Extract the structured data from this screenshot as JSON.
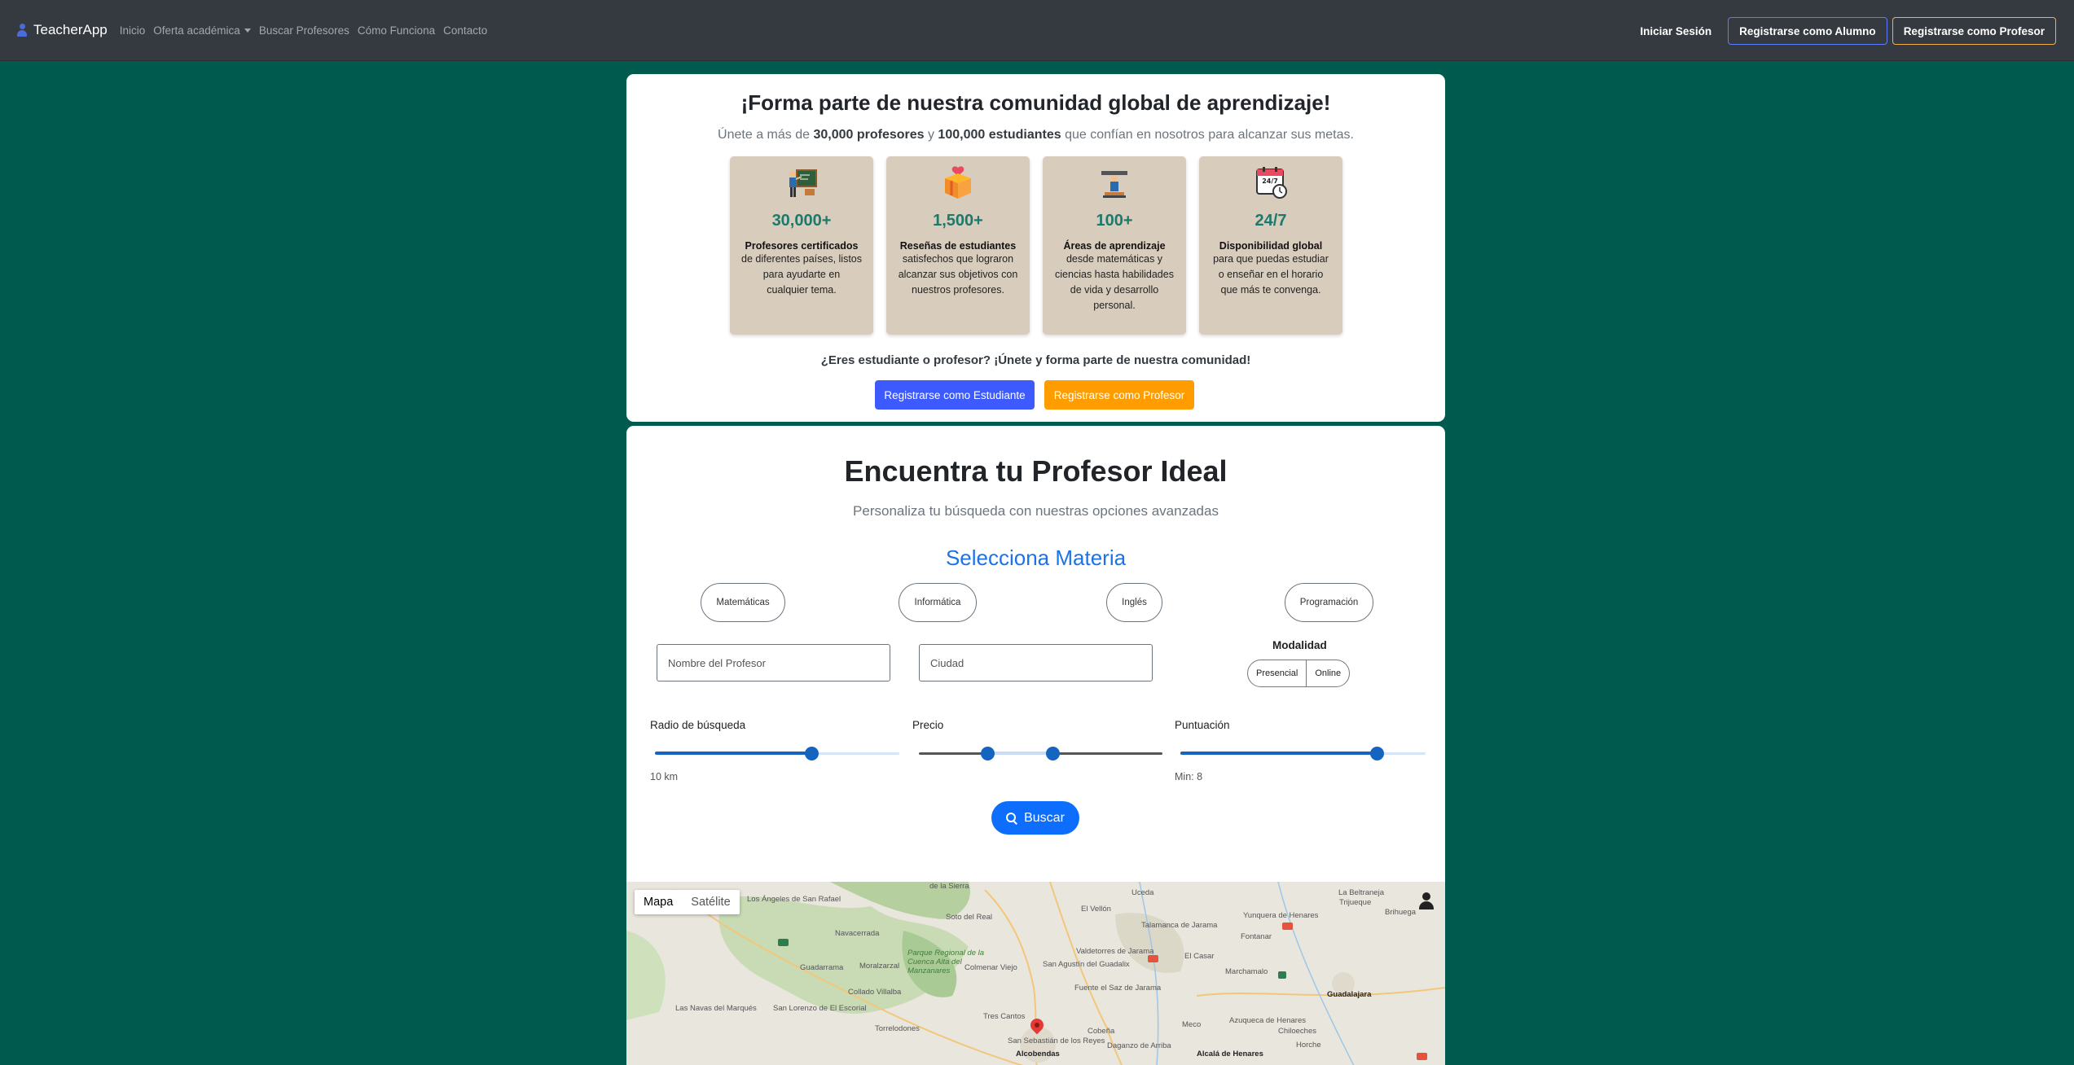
{
  "navbar": {
    "brand": "TeacherApp",
    "links": [
      "Inicio",
      "Oferta académica",
      "Buscar Profesores",
      "Cómo Funciona",
      "Contacto"
    ],
    "login": "Iniciar Sesión",
    "register_student": "Registrarse como Alumno",
    "register_teacher": "Registrarse como Profesor"
  },
  "community": {
    "title": "¡Forma parte de nuestra comunidad global de aprendizaje!",
    "lead_prefix": "Únete a más de ",
    "lead_teachers": "30,000 profesores",
    "lead_and": " y ",
    "lead_students": "100,000 estudiantes",
    "lead_suffix": " que confían en nosotros para alcanzar sus metas.",
    "stats": [
      {
        "icon": "teacher-icon",
        "number": "30,000+",
        "title": "Profesores certificados",
        "desc": "de diferentes países, listos para ayudarte en cualquier tema."
      },
      {
        "icon": "gift-box-icon",
        "number": "1,500+",
        "title": "Reseñas de estudiantes",
        "desc": "satisfechos que lograron alcanzar sus objetivos con nuestros profesores."
      },
      {
        "icon": "learning-areas-icon",
        "number": "100+",
        "title": "Áreas de aprendizaje",
        "desc": "desde matemáticas y ciencias hasta habilidades de vida y desarrollo personal."
      },
      {
        "icon": "calendar-clock-icon",
        "number": "24/7",
        "title": "Disponibilidad global",
        "desc": "para que puedas estudiar o enseñar en el horario que más te convenga."
      }
    ],
    "cta_text": "¿Eres estudiante o profesor? ¡Únete y forma parte de nuestra comunidad!",
    "btn_student": "Registrarse como Estudiante",
    "btn_teacher": "Registrarse como Profesor"
  },
  "search": {
    "title": "Encuentra tu Profesor Ideal",
    "subtitle": "Personaliza tu búsqueda con nuestras opciones avanzadas",
    "subject_heading": "Selecciona Materia",
    "subjects": [
      "Matemáticas",
      "Informática",
      "Inglés",
      "Programación"
    ],
    "teacher_placeholder": "Nombre del Profesor",
    "city_placeholder": "Ciudad",
    "modality_label": "Modalidad",
    "modality_options": [
      "Presencial",
      "Online"
    ],
    "radius_label": "Radio de búsqueda",
    "radius_value": "10 km",
    "radius_level": 0.64,
    "price_label": "Precio",
    "price_range": [
      0.28,
      0.55
    ],
    "rating_label": "Puntuación",
    "rating_value": "Min: 8",
    "rating_level": 0.8,
    "search_button": "Buscar"
  },
  "map": {
    "tab_map": "Mapa",
    "tab_satellite": "Satélite",
    "labels": [
      "de la Sierra",
      "Los Ángeles de San Rafael",
      "Navacerrada",
      "Soto del Real",
      "El Vellón",
      "Valdetorres de Jarama",
      "Uceda",
      "Talamanca de Jarama",
      "El Casar",
      "Yunquera de Henares",
      "La Beltraneja",
      "Trijueque",
      "Fontanar",
      "Brihuega",
      "Guadarrama",
      "Moralzarzal",
      "Colmenar Viejo",
      "San Agustín del Guadalix",
      "Fuente el Saz de Jarama",
      "Collado Villalba",
      "Marchamalo",
      "Guadalajara",
      "Las Navas del Marqués",
      "San Lorenzo de El Escorial",
      "Torrelodones",
      "Tres Cantos",
      "San Sebastián de los Reyes",
      "Alcobendas",
      "Cobeña",
      "Daganzo de Arriba",
      "Alcalá de Henares",
      "Chiloeches",
      "Horche",
      "Azuqueca de Henares",
      "Parque Regional de la Cuenca Alta del Manzanares",
      "Meco"
    ]
  }
}
